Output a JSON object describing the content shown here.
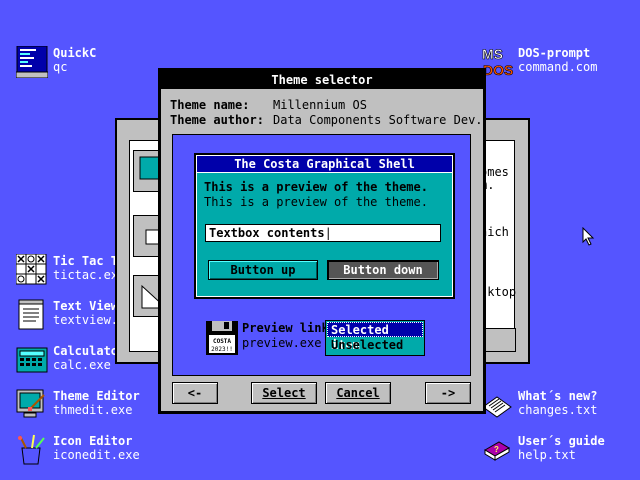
{
  "desktop": {
    "icons": [
      {
        "id": "quickc",
        "title": "QuickC",
        "file": "qc"
      },
      {
        "id": "dos",
        "title": "DOS-prompt",
        "file": "command.com"
      },
      {
        "id": "tictac",
        "title": "Tic Tac Toe",
        "file": "tictac.exe"
      },
      {
        "id": "textview",
        "title": "Text Viewer",
        "file": "textview.exe"
      },
      {
        "id": "calc",
        "title": "Calculator",
        "file": "calc.exe"
      },
      {
        "id": "thmedit",
        "title": "Theme Editor",
        "file": "thmedit.exe"
      },
      {
        "id": "iconedit",
        "title": "Icon Editor",
        "file": "iconedit.exe"
      },
      {
        "id": "changes",
        "title": "What´s new?",
        "file": "changes.txt"
      },
      {
        "id": "help",
        "title": "User´s guide",
        "file": "help.txt"
      }
    ],
    "dos_logo": {
      "ms": "MS",
      "dos": "DOS"
    },
    "background_color": "#5555ff"
  },
  "background_window": {
    "text_lines": [
      "omes",
      "m.",
      "hich",
      "sktop"
    ]
  },
  "theme_selector": {
    "title": "Theme selector",
    "name_label": "Theme name:",
    "name_value": "Millennium OS",
    "author_label": "Theme author:",
    "author_value": "Data Components Software Dev.",
    "preview": {
      "title": "The Costa Graphical Shell",
      "text_bold": "This is a preview of the theme.",
      "text_normal": "This is a preview of the theme.",
      "textbox": "Textbox contents",
      "button_up": "Button up",
      "button_down": "Button down",
      "link_title": "Preview link",
      "link_file": "preview.exe",
      "disk_label": "COSTA 2023!!",
      "selected_item": "Selected item",
      "unselected": "Unselected"
    },
    "buttons": {
      "prev": "<-",
      "select": "Select",
      "cancel": "Cancel",
      "next": "->"
    }
  },
  "colors": {
    "desktop": "#5555ff",
    "preview_bg": "#00aaaa",
    "preview_title": "#0000aa",
    "window_gray": "#c0c0c0"
  }
}
